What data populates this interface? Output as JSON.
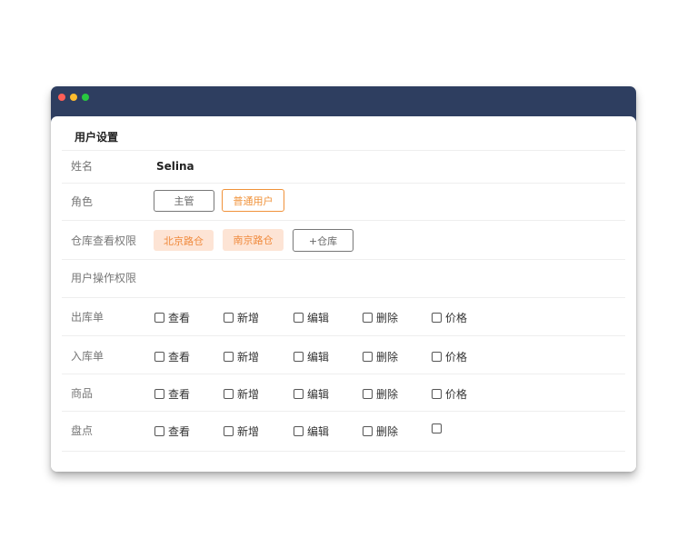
{
  "panel": {
    "title": "用户设置"
  },
  "name": {
    "label": "姓名",
    "value": "Selina"
  },
  "role": {
    "label": "角色",
    "options": [
      "主管",
      "普通用户"
    ],
    "selected": "普通用户"
  },
  "warehouse": {
    "label": "仓库查看权限",
    "tags": [
      "北京路仓",
      "南京路仓"
    ],
    "add_label": "+仓库"
  },
  "operations": {
    "label": "用户操作权限"
  },
  "permissions": [
    {
      "label": "出库单",
      "actions": [
        "查看",
        "新增",
        "编辑",
        "删除",
        "价格"
      ]
    },
    {
      "label": "入库单",
      "actions": [
        "查看",
        "新增",
        "编辑",
        "删除",
        "价格"
      ]
    },
    {
      "label": "商品",
      "actions": [
        "查看",
        "新增",
        "编辑",
        "删除",
        "价格"
      ]
    },
    {
      "label": "盘点",
      "actions": [
        "查看",
        "新增",
        "编辑",
        "删除",
        ""
      ]
    }
  ],
  "colors": {
    "titlebar": "#2e3e60",
    "accent": "#f0923a",
    "tag_bg": "#fde4d5"
  }
}
